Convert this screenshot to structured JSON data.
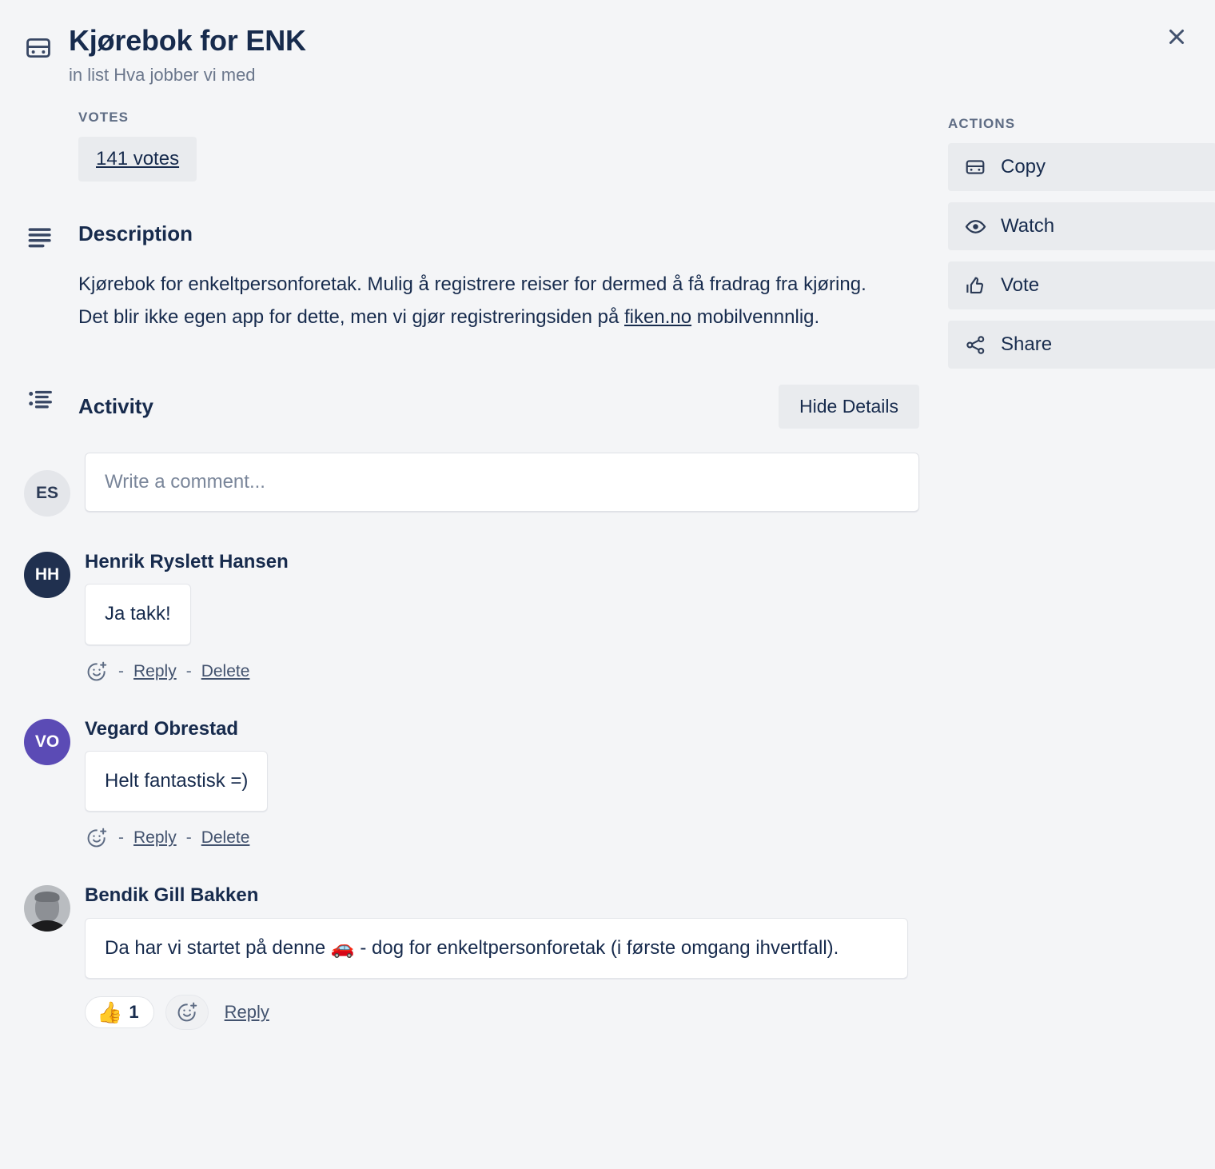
{
  "card": {
    "title": "Kjørebok for ENK",
    "subtitle": "in list Hva jobber vi med",
    "icon": "card-icon",
    "close_icon": "close-icon"
  },
  "votes": {
    "label": "VOTES",
    "button_text": "141 votes",
    "count": 141
  },
  "description": {
    "heading": "Description",
    "icon": "description-lines-icon",
    "text_before_link": "Kjørebok for enkeltpersonforetak. Mulig å registrere reiser for dermed å få fradrag fra kjøring. Det blir ikke egen app for dette, men vi gjør registreringsiden på ",
    "link_text": "fiken.no",
    "text_after_link": " mobilvennnlig."
  },
  "activity": {
    "heading": "Activity",
    "icon": "activity-list-icon",
    "hide_details_label": "Hide Details",
    "composer": {
      "avatar_initials": "ES",
      "placeholder": "Write a comment...",
      "value": ""
    },
    "comments": [
      {
        "author": "Henrik Ryslett Hansen",
        "avatar_initials": "HH",
        "avatar_color": "#20304f",
        "avatar_type": "initials",
        "text": "Ja takk!",
        "actions": [
          "Reply",
          "Delete"
        ],
        "emoji_add_icon": "emoji-add-icon",
        "separator": "-",
        "reactions": []
      },
      {
        "author": "Vegard Obrestad",
        "avatar_initials": "VO",
        "avatar_color": "#5b4bb5",
        "avatar_type": "initials",
        "text": "Helt fantastisk =)",
        "actions": [
          "Reply",
          "Delete"
        ],
        "emoji_add_icon": "emoji-add-icon",
        "separator": "-",
        "reactions": []
      },
      {
        "author": "Bendik Gill Bakken",
        "avatar_initials": "",
        "avatar_color": "#b9bcc0",
        "avatar_type": "photo",
        "text": "Da har vi startet på denne 🚗 - dog for enkeltpersonforetak (i første omgang ihvertfall).",
        "actions": [
          "Reply"
        ],
        "emoji_add_icon": "emoji-add-icon",
        "reactions": [
          {
            "emoji": "👍",
            "count": "1"
          }
        ]
      }
    ]
  },
  "actions": {
    "label": "ACTIONS",
    "items": [
      {
        "label": "Copy",
        "icon": "card-icon"
      },
      {
        "label": "Watch",
        "icon": "eye-icon"
      },
      {
        "label": "Vote",
        "icon": "thumbs-up-icon"
      },
      {
        "label": "Share",
        "icon": "share-nodes-icon"
      }
    ]
  },
  "colors": {
    "page_background": "#f4f5f7",
    "text_primary": "#172b4d",
    "text_muted": "#6b778c",
    "button_background": "#e9ebee",
    "avatar_navy": "#20304f",
    "avatar_purple": "#5b4bb5"
  }
}
